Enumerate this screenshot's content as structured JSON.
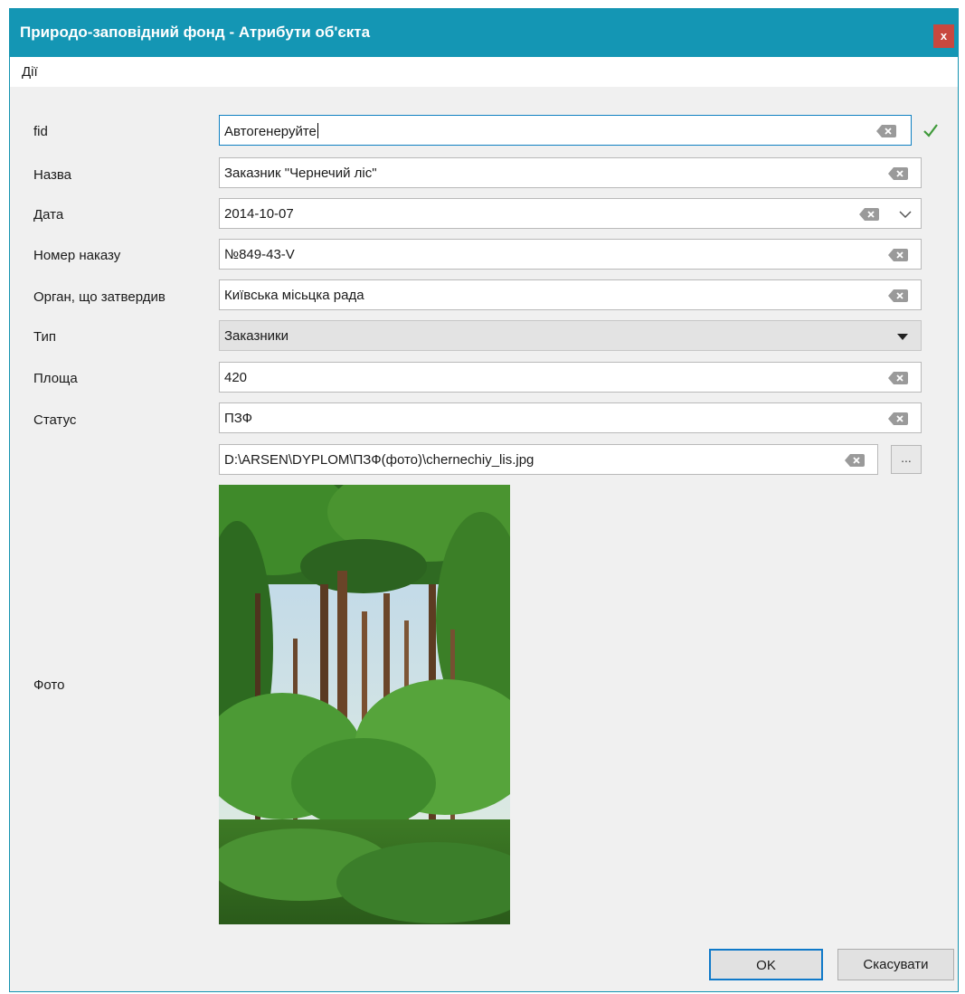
{
  "window": {
    "title": "Природо-заповідний фонд - Атрибути об'єкта",
    "close_label": "x"
  },
  "menu": {
    "actions_first": "Д",
    "actions_rest": "ії"
  },
  "form": {
    "fid": {
      "label": "fid",
      "value": "Автогенеруйте"
    },
    "name": {
      "label": "Назва",
      "value": "Заказник \"Чернечий ліс\""
    },
    "date": {
      "label": "Дата",
      "value": "2014-10-07"
    },
    "order": {
      "label": "Номер наказу",
      "value": "№849-43-V"
    },
    "authority": {
      "label": "Орган, що затвердив",
      "value": "Київська місьцка рада"
    },
    "type": {
      "label": "Тип",
      "value": "Заказники"
    },
    "area": {
      "label": "Площа",
      "value": "420"
    },
    "status": {
      "label": "Статус",
      "value": "ПЗФ"
    },
    "photo": {
      "label": "Фото",
      "path": "D:\\ARSEN\\DYPLOM\\ПЗФ(фото)\\chernechiy_lis.jpg",
      "browse_label": "..."
    }
  },
  "buttons": {
    "ok": "OK",
    "cancel": "Скасувати"
  },
  "colors": {
    "titlebar": "#1496b4",
    "close": "#c8483f",
    "valid_check": "#3f9a3a",
    "focus_border": "#0f80c2"
  },
  "icons": {
    "clear": "backspace-clear-icon",
    "valid": "checkmark-icon",
    "dropdown": "triangle-down-icon",
    "calendar": "chevron-down-icon"
  }
}
